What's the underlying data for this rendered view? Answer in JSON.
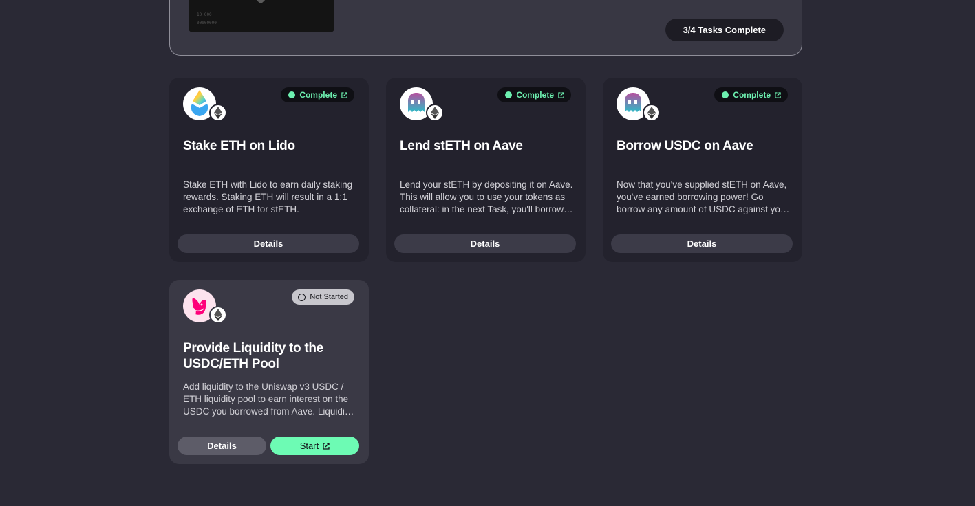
{
  "banner": {
    "image_text_1": "10  000",
    "image_text_2": "00000000",
    "progress_label": "3/4 Tasks Complete"
  },
  "colors": {
    "background": "#2a2935",
    "card": "#23222d",
    "complete": "#6df0b0",
    "start_button": "#6dfbb4"
  },
  "tasks": [
    {
      "icon": "lido-icon",
      "chain_icon": "ethereum-icon",
      "status": "Complete",
      "title": "Stake ETH on Lido",
      "description": "Stake ETH with Lido to earn daily staking rewards. Staking ETH will result in a 1:1 exchange of ETH for stETH.",
      "details_label": "Details"
    },
    {
      "icon": "aave-icon",
      "chain_icon": "ethereum-icon",
      "status": "Complete",
      "title": "Lend stETH on Aave",
      "description": "Lend your stETH by depositing it on Aave. This will allow you to use your tokens as collateral: in the next Task, you'll borrow against it.",
      "details_label": "Details"
    },
    {
      "icon": "aave-icon",
      "chain_icon": "ethereum-icon",
      "status": "Complete",
      "title": "Borrow USDC on Aave",
      "description": "Now that you've supplied stETH on Aave, you've earned borrowing power! Go borrow any amount of USDC against your collateral.",
      "details_label": "Details"
    },
    {
      "icon": "uniswap-icon",
      "chain_icon": "ethereum-icon",
      "status": "Not Started",
      "title": "Provide Liquidity to the USDC/ETH Pool",
      "description": "Add liquidity to the Uniswap v3 USDC / ETH liquidity pool to earn interest on the USDC you borrowed from Aave. Liquidity providers earn fees.",
      "details_label": "Details",
      "start_label": "Start"
    }
  ]
}
